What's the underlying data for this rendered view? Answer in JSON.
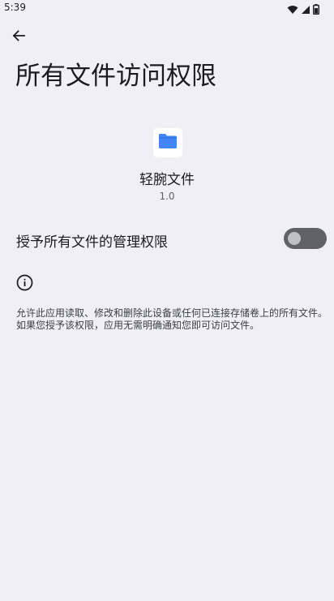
{
  "status_bar": {
    "time": "5:39",
    "icons": [
      "wifi-icon",
      "signal-icon",
      "battery-icon"
    ]
  },
  "header": {
    "back_icon": "arrow-back-icon",
    "title": "所有文件访问权限"
  },
  "app": {
    "icon": "folder-icon",
    "icon_color": "#4285f4",
    "name": "轻腕文件",
    "version": "1.0"
  },
  "permission": {
    "label": "授予所有文件的管理权限",
    "enabled": false
  },
  "info": {
    "icon": "info-icon",
    "description": "允许此应用读取、修改和删除此设备或任何已连接存储卷上的所有文件。如果您授予该权限，应用无需明确通知您即可访问文件。"
  },
  "colors": {
    "background": "#efeff5",
    "toggle_track_off": "#5f6368",
    "toggle_thumb_off": "#bdc1c6"
  }
}
